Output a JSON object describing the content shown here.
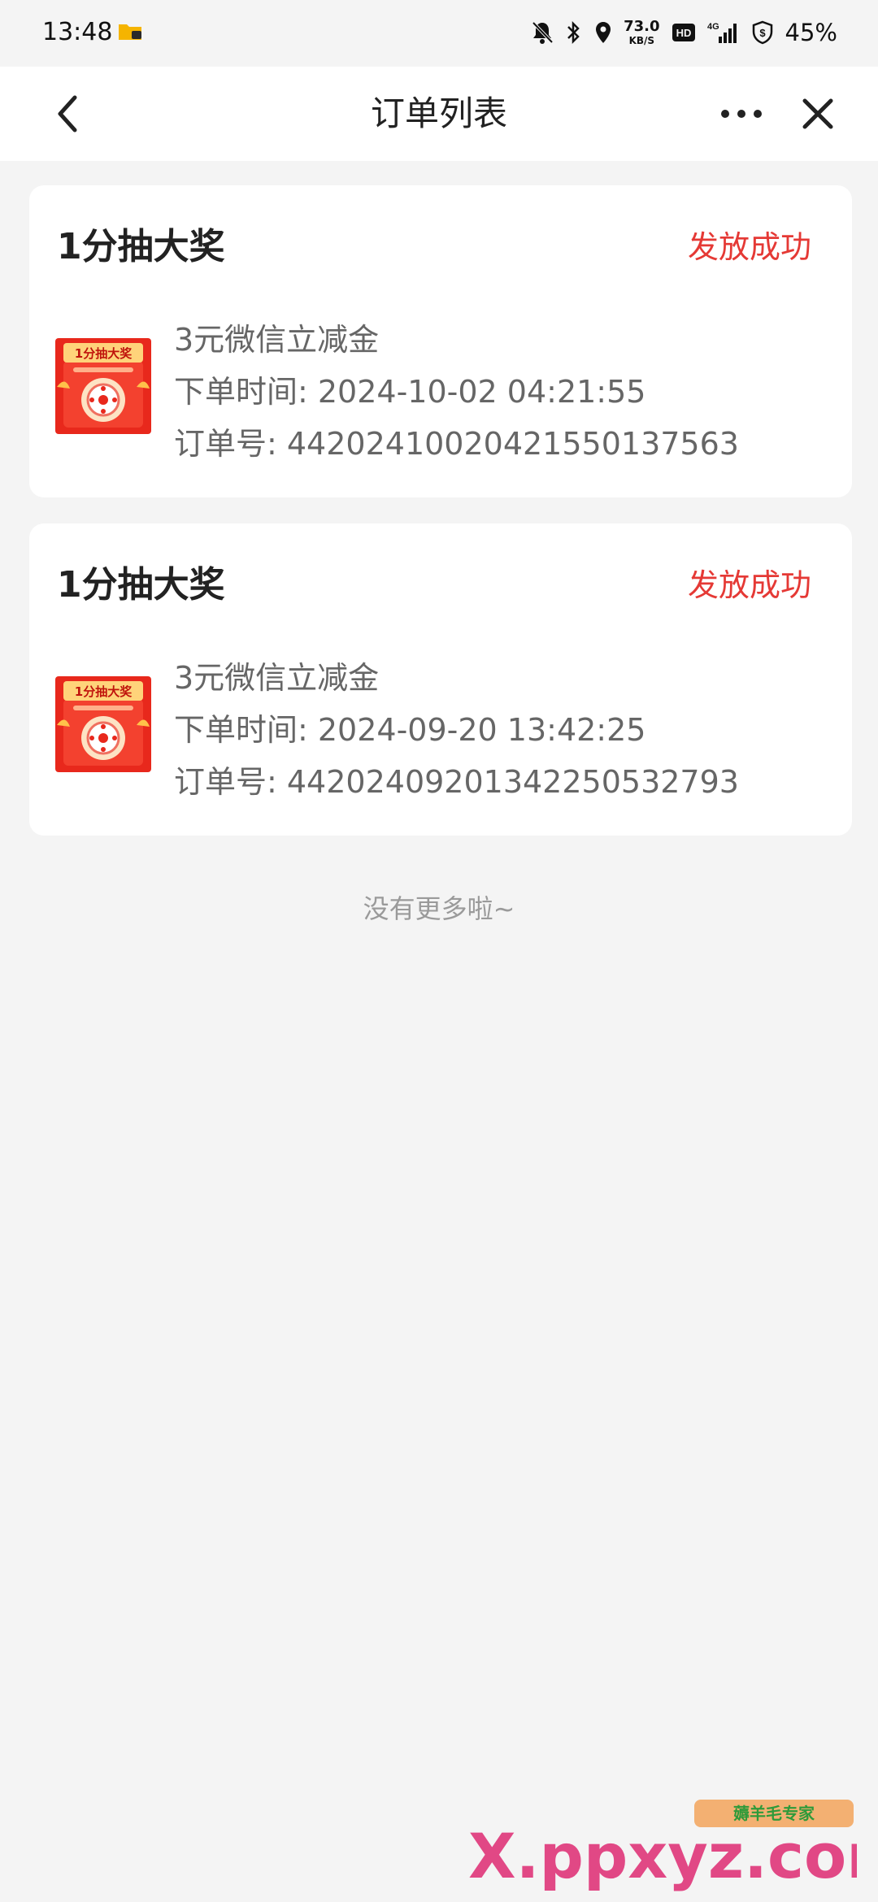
{
  "status_bar": {
    "time": "13:48",
    "app_icon": "folder-app-icon",
    "icons": [
      "bell-off-icon",
      "bluetooth-icon",
      "location-icon"
    ],
    "net_speed_value": "73.0",
    "net_speed_unit": "KB/S",
    "hd_label": "HD",
    "signal_label": "4G",
    "battery_text": "45%"
  },
  "header": {
    "title": "订单列表",
    "back_icon": "chevron-left-icon",
    "more_icon": "more-dots-icon",
    "close_icon": "close-icon"
  },
  "orders": [
    {
      "title": "1分抽大奖",
      "status": "发放成功",
      "thumb_label": "1分抽大奖",
      "item": "3元微信立减金",
      "time_line": "下单时间: 2024-10-02 04:21:55",
      "order_line": "订单号: 442024100204215501375​63"
    },
    {
      "title": "1分抽大奖",
      "status": "发放成功",
      "thumb_label": "1分抽大奖",
      "item": "3元微信立减金",
      "time_line": "下单时间: 2024-09-20 13:42:25",
      "order_line": "订单号: 442024092013422505327​93"
    }
  ],
  "footer": {
    "no_more": "没有更多啦~"
  },
  "watermark": {
    "text": "X.ppxyz.com",
    "badge": "薅羊毛专家"
  },
  "colors": {
    "status_red": "#e53935",
    "background": "#f4f4f4",
    "card": "#ffffff"
  }
}
